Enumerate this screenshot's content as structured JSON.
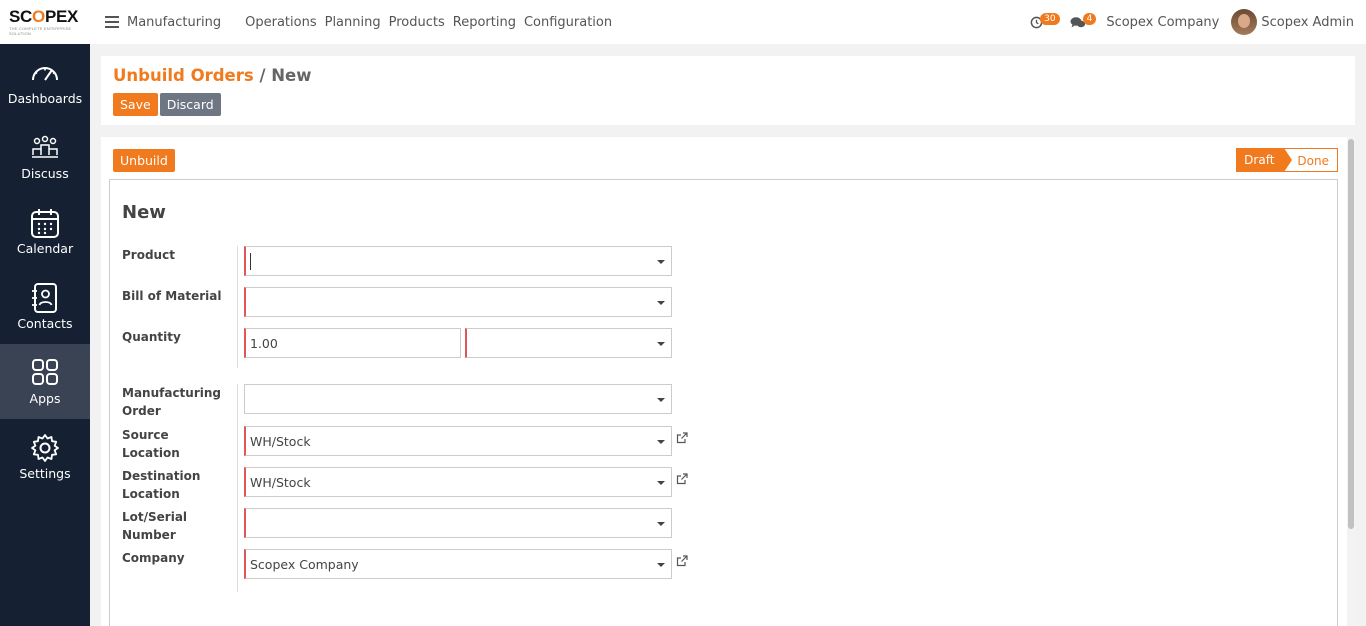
{
  "brand": {
    "logo_left": "SC",
    "logo_o": "O",
    "logo_right": "PEX",
    "tagline": "THE COMPLETE ENTERPRISE SOLUTION"
  },
  "topbar": {
    "app_name": "Manufacturing",
    "menu": [
      "Operations",
      "Planning",
      "Products",
      "Reporting",
      "Configuration"
    ],
    "activity_count": "30",
    "messages_count": "4",
    "company": "Scopex Company",
    "user": "Scopex Admin"
  },
  "sidebar": {
    "items": [
      {
        "label": "Dashboards",
        "icon": "gauge-icon"
      },
      {
        "label": "Discuss",
        "icon": "people-icon"
      },
      {
        "label": "Calendar",
        "icon": "calendar-icon"
      },
      {
        "label": "Contacts",
        "icon": "contact-book-icon"
      },
      {
        "label": "Apps",
        "icon": "grid-icon"
      },
      {
        "label": "Settings",
        "icon": "gear-icon"
      }
    ]
  },
  "control": {
    "breadcrumb_parent": "Unbuild Orders",
    "breadcrumb_sep": "/",
    "breadcrumb_current": "New",
    "save_label": "Save",
    "discard_label": "Discard"
  },
  "form": {
    "unbuild_label": "Unbuild",
    "status": {
      "draft": "Draft",
      "done": "Done"
    },
    "title": "New",
    "fields": {
      "product": {
        "label": "Product",
        "value": ""
      },
      "bom": {
        "label": "Bill of Material",
        "value": ""
      },
      "quantity": {
        "label": "Quantity",
        "value": "1.00",
        "uom": ""
      },
      "mo": {
        "label": "Manufacturing Order",
        "value": ""
      },
      "source": {
        "label": "Source Location",
        "value": "WH/Stock"
      },
      "destination": {
        "label": "Destination Location",
        "value": "WH/Stock"
      },
      "lot": {
        "label": "Lot/Serial Number",
        "value": ""
      },
      "company": {
        "label": "Company",
        "value": "Scopex Company"
      }
    }
  },
  "colors": {
    "accent": "#f07a1d",
    "sidebar": "#152033",
    "sidebar_active": "#3a4354",
    "secondary_button": "#6e7583",
    "required": "#e05555"
  }
}
